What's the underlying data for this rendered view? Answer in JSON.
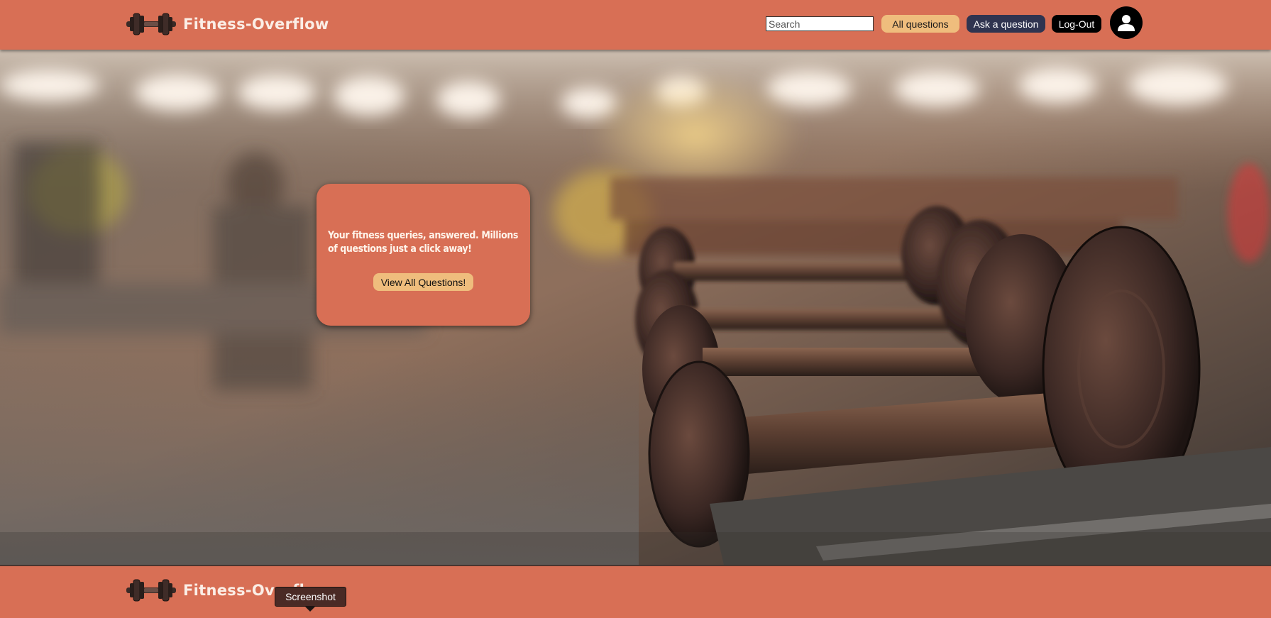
{
  "header": {
    "brand_name": "Fitness-Overflow",
    "logo_icon": "dumbbell-icon",
    "search": {
      "placeholder": "Search",
      "value": ""
    },
    "nav": {
      "all_questions_label": "All questions",
      "ask_question_label": "Ask a question",
      "logout_label": "Log-Out"
    },
    "avatar_icon": "user-icon"
  },
  "hero": {
    "background": "gym-dumbbell-rack-photo",
    "card": {
      "text": "Your fitness queries, answered. Millions of questions just a click away!",
      "button_label": "View All Questions!"
    }
  },
  "footer": {
    "brand_name": "Fitness-Overflow",
    "logo_icon": "dumbbell-icon"
  },
  "tooltip": {
    "text": "Screenshot"
  },
  "colors": {
    "primary": "#d86f55",
    "accent": "#efbd7d",
    "ask_button": "#2f3450",
    "logout_button": "#000000",
    "brand_text": "#fbeee6"
  }
}
